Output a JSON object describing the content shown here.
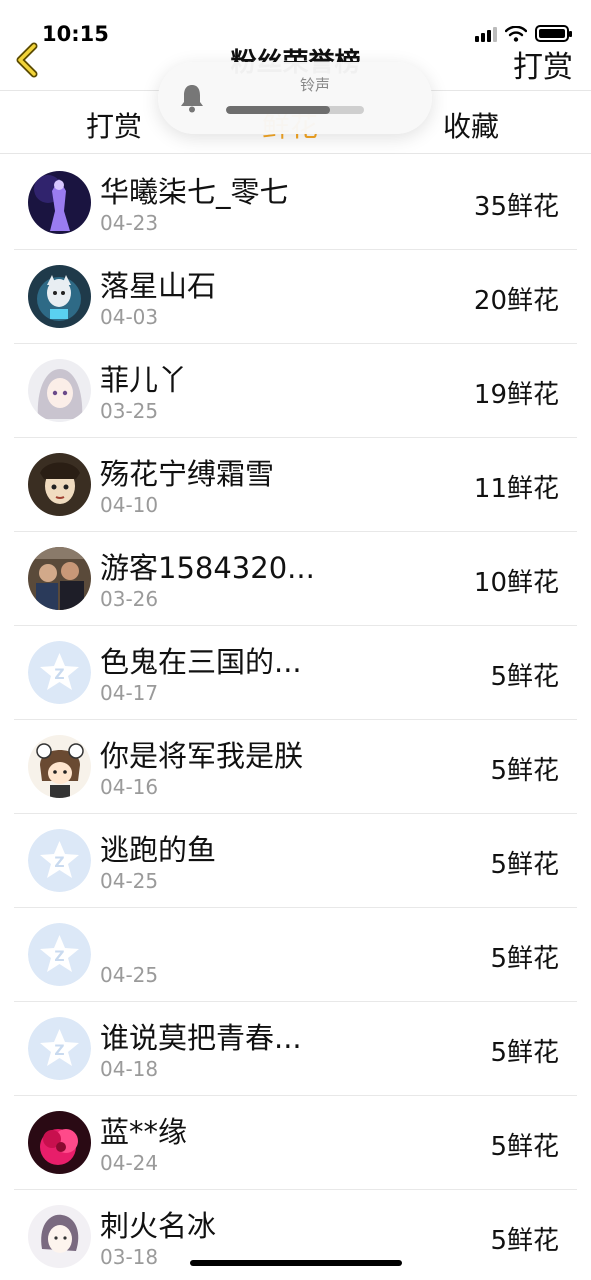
{
  "status": {
    "time": "10:15"
  },
  "nav": {
    "title": "粉丝荣誉榜",
    "right_label": "打赏"
  },
  "tabs": [
    {
      "label": "打赏",
      "active": false
    },
    {
      "label": "鲜花",
      "active": true
    },
    {
      "label": "收藏",
      "active": false
    }
  ],
  "hud": {
    "label": "铃声",
    "level": 0.75
  },
  "colors": {
    "accent": "#f5a623",
    "default_avatar": "#dce8f7"
  },
  "rows": [
    {
      "name": "华曦柒七_零七",
      "date": "04-23",
      "amount": "35鲜花",
      "avatar": "avatar-dark-figure"
    },
    {
      "name": "落星山石",
      "date": "04-03",
      "amount": "20鲜花",
      "avatar": "avatar-character"
    },
    {
      "name": "菲儿丫",
      "date": "03-25",
      "amount": "19鲜花",
      "avatar": "avatar-anime-girl"
    },
    {
      "name": "殇花宁缚霜雪",
      "date": "04-10",
      "amount": "11鲜花",
      "avatar": "avatar-sketch"
    },
    {
      "name": "游客1584320...",
      "date": "03-26",
      "amount": "10鲜花",
      "avatar": "avatar-photo"
    },
    {
      "name": "色鬼在三国的...",
      "date": "04-17",
      "amount": "5鲜花",
      "avatar": "default-avatar-icon"
    },
    {
      "name": "你是将军我是朕",
      "date": "04-16",
      "amount": "5鲜花",
      "avatar": "avatar-cartoon"
    },
    {
      "name": "逃跑的鱼",
      "date": "04-25",
      "amount": "5鲜花",
      "avatar": "default-avatar-icon"
    },
    {
      "name": "",
      "date": "04-25",
      "amount": "5鲜花",
      "avatar": "default-avatar-icon"
    },
    {
      "name": "谁说莫把青春...",
      "date": "04-18",
      "amount": "5鲜花",
      "avatar": "default-avatar-icon"
    },
    {
      "name": "蓝**缘",
      "date": "04-24",
      "amount": "5鲜花",
      "avatar": "avatar-flower"
    },
    {
      "name": "刺火名冰",
      "date": "03-18",
      "amount": "5鲜花",
      "avatar": "avatar-drawing"
    }
  ]
}
